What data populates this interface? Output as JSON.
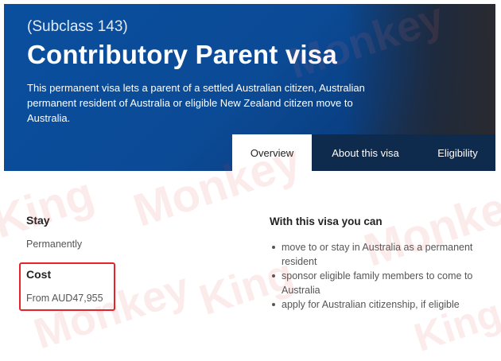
{
  "hero": {
    "subclass": "(Subclass 143)",
    "title": "Contributory Parent visa",
    "description": "This permanent visa lets a parent of a settled Australian citizen, Australian permanent resident of Australia or eligible New Zealand citizen move to Australia."
  },
  "tabs": [
    {
      "label": "Overview",
      "active": true
    },
    {
      "label": "About this visa",
      "active": false
    },
    {
      "label": "Eligibility",
      "active": false
    }
  ],
  "stay": {
    "heading": "Stay",
    "value": "Permanently"
  },
  "cost": {
    "heading": "Cost",
    "value": "From AUD47,955",
    "highlight_color": "#e8222a"
  },
  "with_visa": {
    "heading": "With this visa you can",
    "items": [
      "move to or stay in Australia as a permanent resident",
      "sponsor eligible family members to come to Australia",
      "apply for Australian citizenship, if eligible"
    ]
  },
  "colors": {
    "hero_blue": "#0a4f9f",
    "tab_dark": "#0e2a4c"
  }
}
